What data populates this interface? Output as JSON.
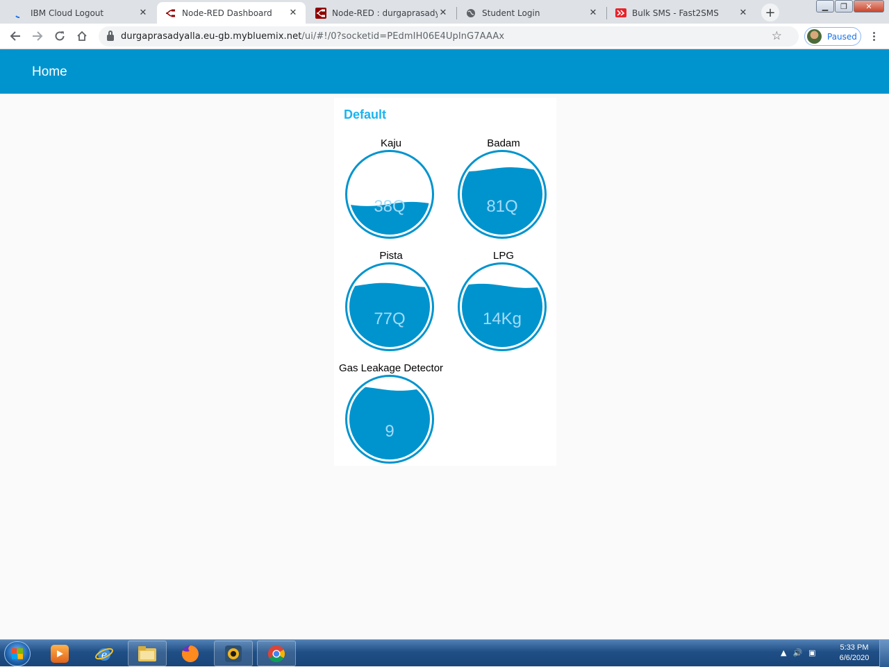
{
  "browser": {
    "tabs": [
      {
        "title": "IBM Cloud Logout",
        "icon": "loading-spinner-icon",
        "active": false
      },
      {
        "title": "Node-RED Dashboard",
        "icon": "node-red-icon",
        "active": true
      },
      {
        "title": "Node-RED : durgaprasadyalla",
        "icon": "node-red-icon",
        "active": false
      },
      {
        "title": "Student Login",
        "icon": "globe-icon",
        "active": false
      },
      {
        "title": "Bulk SMS - Fast2SMS",
        "icon": "fast2sms-icon",
        "active": false
      }
    ],
    "url_host": "durgaprasadyalla.eu-gb.mybluemix.net",
    "url_path": "/ui/#!/0?socketid=PEdmIH06E4UpInG7AAAx",
    "profile_label": "Paused"
  },
  "dashboard": {
    "title": "Home",
    "group_title": "Default",
    "accent_color": "#0094ce",
    "gauges": [
      {
        "label": "Kaju",
        "value": "38Q",
        "level": 0.38
      },
      {
        "label": "Badam",
        "value": "81Q",
        "level": 0.81
      },
      {
        "label": "Pista",
        "value": "77Q",
        "level": 0.77
      },
      {
        "label": "LPG",
        "value": "14Kg",
        "level": 0.76
      },
      {
        "label": "Gas Leakage Detector",
        "value": "9",
        "level": 0.88
      }
    ]
  },
  "taskbar": {
    "apps": [
      "media-player-icon",
      "internet-explorer-icon",
      "file-explorer-icon",
      "firefox-icon",
      "media-center-icon",
      "chrome-icon"
    ],
    "time": "5:33 PM",
    "date": "6/6/2020"
  }
}
